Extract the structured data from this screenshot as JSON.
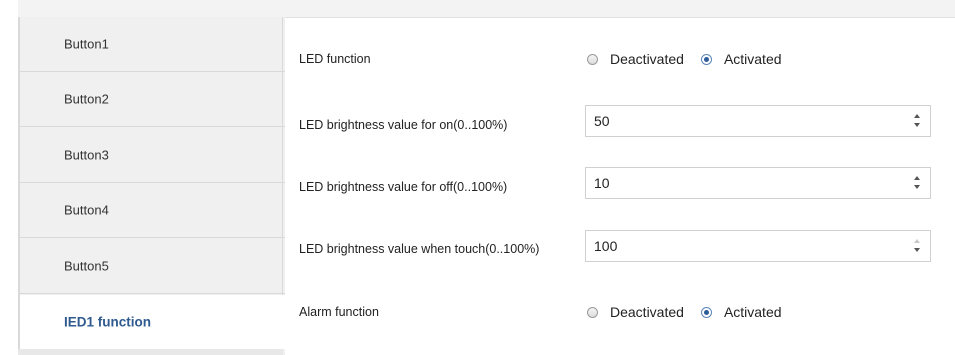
{
  "sidebar": {
    "items": [
      {
        "label": "Button1"
      },
      {
        "label": "Button2"
      },
      {
        "label": "Button3"
      },
      {
        "label": "Button4"
      },
      {
        "label": "Button5"
      },
      {
        "label": "IED1 function",
        "active": true
      }
    ]
  },
  "settings": {
    "led_function": {
      "label": "LED function",
      "options": [
        "Deactivated",
        "Activated"
      ],
      "selected": "Activated"
    },
    "brightness_on": {
      "label": "LED brightness value for on(0..100%)",
      "value": "50"
    },
    "brightness_off": {
      "label": "LED brightness value for off(0..100%)",
      "value": "10"
    },
    "brightness_touch": {
      "label": "LED brightness value when touch(0..100%)",
      "value": "100",
      "at_max": true
    },
    "alarm_function": {
      "label": "Alarm function",
      "options": [
        "Deactivated",
        "Activated"
      ],
      "selected": "Activated"
    }
  },
  "colors": {
    "active_tab_text": "#2f5a8f",
    "sidebar_bg": "#f0f0f0",
    "radio_checked": "#2c5d9a"
  },
  "icons": {
    "spin_up": "spin-up-arrow-icon",
    "spin_down": "spin-down-arrow-icon",
    "radio": "radio-button-icon"
  }
}
